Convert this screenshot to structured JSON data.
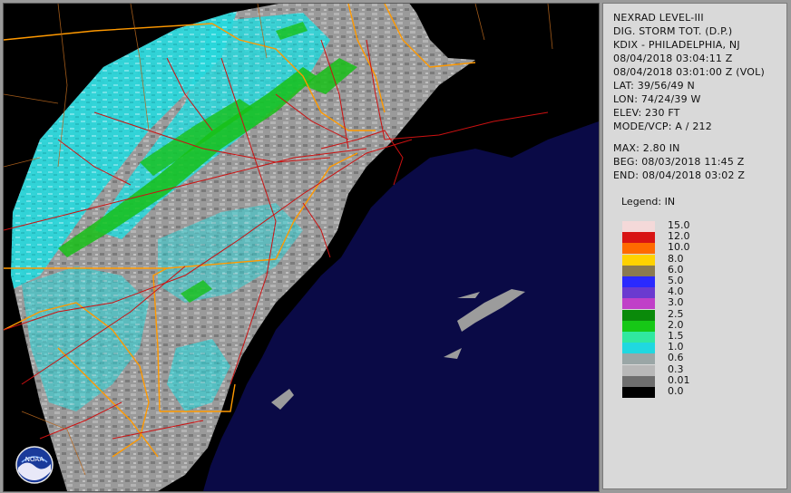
{
  "product": {
    "title": "NEXRAD LEVEL-III",
    "name": "DIG. STORM TOT. (D.P.)",
    "station": "KDIX - PHILADELPHIA, NJ",
    "time_generated": "08/04/2018 03:04:11 Z",
    "time_volume": "08/04/2018 03:01:00 Z (VOL)",
    "lat": "LAT: 39/56/49 N",
    "lon": "LON: 74/24/39 W",
    "elev": "ELEV: 230 FT",
    "mode": "MODE/VCP: A / 212",
    "max": "MAX: 2.80 IN",
    "begin": "BEG: 08/03/2018 11:45 Z",
    "end": "END: 08/04/2018 03:02 Z"
  },
  "legend": {
    "title": "Legend: IN",
    "entries": [
      {
        "label": "15.0",
        "color": "#f4d9d9"
      },
      {
        "label": "12.0",
        "color": "#d81414"
      },
      {
        "label": "10.0",
        "color": "#ff6a00"
      },
      {
        "label": "8.0",
        "color": "#ffd200"
      },
      {
        "label": "6.0",
        "color": "#8a7a50"
      },
      {
        "label": "5.0",
        "color": "#2a2aff"
      },
      {
        "label": "4.0",
        "color": "#6a3ad0"
      },
      {
        "label": "3.0",
        "color": "#c040c8"
      },
      {
        "label": "2.5",
        "color": "#0a8a0a"
      },
      {
        "label": "2.0",
        "color": "#16c816"
      },
      {
        "label": "1.5",
        "color": "#30e8a0"
      },
      {
        "label": "1.0",
        "color": "#20d8e0"
      },
      {
        "label": "0.6",
        "color": "#9aa6a6"
      },
      {
        "label": "0.3",
        "color": "#b8b8b8"
      },
      {
        "label": "0.01",
        "color": "#6e6e6e"
      },
      {
        "label": "0.0",
        "color": "#000000"
      }
    ]
  },
  "map": {
    "ocean_color": "#0a0a46",
    "land_color": "#000000",
    "rain_light_color": "#9c9c9c",
    "rain_cyan_color": "#28d8dc",
    "rain_green_color": "#18c018",
    "state_border_color": "#ff9900",
    "road_color": "#cc1111"
  },
  "logo": {
    "text": "NOAA"
  }
}
